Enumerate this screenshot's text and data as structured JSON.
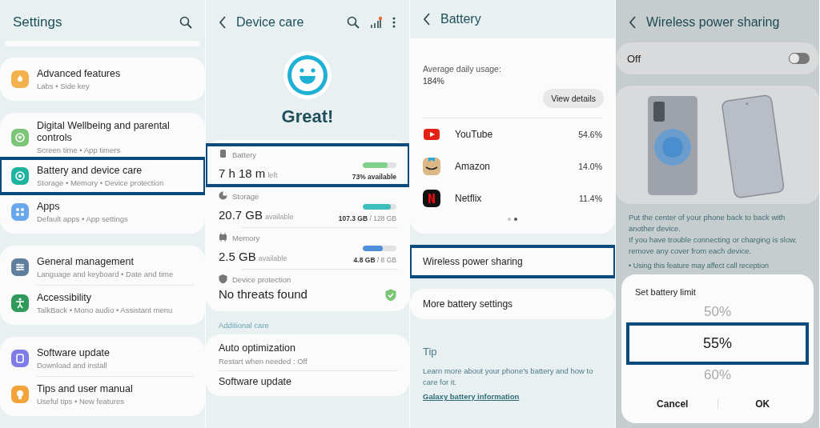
{
  "settings": {
    "title": "Settings",
    "groups": [
      {
        "items": [
          {
            "title": "Advanced features",
            "subtitle": "Labs  •  Side key",
            "color": "#f4b24e",
            "highlighted": false
          }
        ]
      },
      {
        "items": [
          {
            "title": "Digital Wellbeing and parental controls",
            "subtitle": "Screen time  •  App timers",
            "color": "#7cc576",
            "highlighted": false
          },
          {
            "title": "Battery and device care",
            "subtitle": "Storage  •  Memory  •  Device protection",
            "color": "#1fb3a0",
            "highlighted": true
          },
          {
            "title": "Apps",
            "subtitle": "Default apps  •  App settings",
            "color": "#6aa8ee",
            "highlighted": false
          }
        ]
      },
      {
        "items": [
          {
            "title": "General management",
            "subtitle": "Language and keyboard  •  Date and time",
            "color": "#5f7f9c",
            "highlighted": false
          },
          {
            "title": "Accessibility",
            "subtitle": "TalkBack  •  Mono audio  •  Assistant menu",
            "color": "#2f9a5a",
            "highlighted": false
          }
        ]
      },
      {
        "items": [
          {
            "title": "Software update",
            "subtitle": "Download and install",
            "color": "#7f7ee8",
            "highlighted": false
          },
          {
            "title": "Tips and user manual",
            "subtitle": "Useful tips  •  New features",
            "color": "#f2a33a",
            "highlighted": false
          }
        ]
      }
    ]
  },
  "device_care": {
    "title": "Device care",
    "status": "Great!",
    "items": [
      {
        "kind": "meter",
        "label": "Battery",
        "value": "7 h 18 m",
        "unit": "left",
        "level": 0.73,
        "detail": "**73% available**",
        "color": "#7fd08a",
        "highlighted": true
      },
      {
        "kind": "meter",
        "label": "Storage",
        "value": "20.7 GB",
        "unit": "available",
        "level": 0.84,
        "detail": "**107.3 GB** / 128 GB",
        "color": "#3fbcbc",
        "highlighted": false
      },
      {
        "kind": "meter",
        "label": "Memory",
        "value": "2.5 GB",
        "unit": "available",
        "level": 0.6,
        "detail": "**4.8 GB** / 8 GB",
        "color": "#4f8ed8",
        "highlighted": false
      },
      {
        "kind": "protection",
        "label": "Device protection",
        "value": "No threats found",
        "highlighted": false
      }
    ],
    "section_header": "Additional care",
    "additional": [
      {
        "title": "Auto optimization",
        "subtitle": "Restart when needed : Off"
      },
      {
        "title": "Software update"
      }
    ]
  },
  "battery": {
    "title": "Battery",
    "usage_label": "Average daily usage:",
    "usage_value": "184%",
    "button": "View details",
    "apps": [
      {
        "name": "YouTube",
        "percent": "54.6%"
      },
      {
        "name": "Amazon",
        "percent": "14.0%"
      },
      {
        "name": "Netflix",
        "percent": "11.4%"
      }
    ],
    "page_dots": [
      {
        "selected": false
      },
      {
        "selected": true
      }
    ],
    "options": [
      {
        "label": "Wireless power sharing",
        "highlighted": true
      },
      {
        "label": "More battery settings",
        "highlighted": false
      }
    ],
    "tip": {
      "title": "Tip",
      "text": "Learn more about your phone's battery and how to care for it.",
      "link": "Galaxy battery information"
    }
  },
  "wireless_power_sharing": {
    "title": "Wireless power sharing",
    "toggle": {
      "label": "Off",
      "on": false
    },
    "description": [
      "Put the center of your phone back to back with another device.",
      "If you have trouble connecting or charging is slow, remove any cover from each device."
    ],
    "note": "• Using this feature may affect call reception",
    "dialog": {
      "title": "Set battery limit",
      "options": [
        {
          "label": "50%",
          "selected": false
        },
        {
          "label": "55%",
          "selected": true
        },
        {
          "label": "60%",
          "selected": false
        }
      ],
      "picker_highlighted": true,
      "buttons": [
        "Cancel",
        "OK"
      ]
    }
  }
}
